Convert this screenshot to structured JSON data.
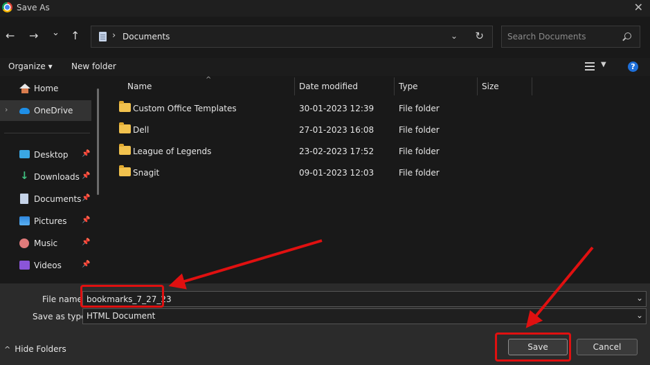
{
  "window": {
    "title": "Save As",
    "app_icon": "chrome-icon",
    "close_glyph": "✕"
  },
  "nav": {
    "back_glyph": "←",
    "forward_glyph": "→",
    "recent_glyph": "⌄",
    "up_glyph": "↑",
    "breadcrumb_sep": "›",
    "breadcrumb": "Documents",
    "address_dropdown_glyph": "⌄",
    "refresh_glyph": "↻",
    "search_placeholder": "Search Documents"
  },
  "commands": {
    "organize": "Organize ▾",
    "new_folder": "New folder",
    "view_dropdown_glyph": "▼",
    "help_glyph": "?"
  },
  "sidebar": {
    "items": [
      {
        "label": "Home",
        "icon": "home-icon",
        "pinned": false
      },
      {
        "label": "OneDrive",
        "icon": "cloud-icon",
        "pinned": false,
        "selected": true,
        "expander": "›"
      },
      {
        "label": "Desktop",
        "icon": "desktop-icon",
        "pinned": true
      },
      {
        "label": "Downloads",
        "icon": "download-icon",
        "pinned": true
      },
      {
        "label": "Documents",
        "icon": "documents-icon",
        "pinned": true
      },
      {
        "label": "Pictures",
        "icon": "pictures-icon",
        "pinned": true
      },
      {
        "label": "Music",
        "icon": "music-icon",
        "pinned": true
      },
      {
        "label": "Videos",
        "icon": "videos-icon",
        "pinned": true
      }
    ],
    "pin_glyph": "📌"
  },
  "columns": {
    "name": "Name",
    "date": "Date modified",
    "type": "Type",
    "size": "Size",
    "sort_glyph": "^"
  },
  "files": [
    {
      "name": "Custom Office Templates",
      "date": "30-01-2023 12:39",
      "type": "File folder"
    },
    {
      "name": "Dell",
      "date": "27-01-2023 16:08",
      "type": "File folder"
    },
    {
      "name": "League of Legends",
      "date": "23-02-2023 17:52",
      "type": "File folder"
    },
    {
      "name": "Snagit",
      "date": "09-01-2023 12:03",
      "type": "File folder"
    }
  ],
  "footer": {
    "file_name_label": "File name:",
    "file_name_value": "bookmarks_7_27_23",
    "save_type_label": "Save as type:",
    "save_type_value": "HTML Document",
    "dropdown_glyph": "⌄",
    "hide_folders_glyph": "^",
    "hide_folders": "Hide Folders",
    "save": "Save",
    "cancel": "Cancel"
  },
  "colors": {
    "annotation": "#e01010",
    "folder": "#f2c24e",
    "accent": "#1e6fd9"
  }
}
